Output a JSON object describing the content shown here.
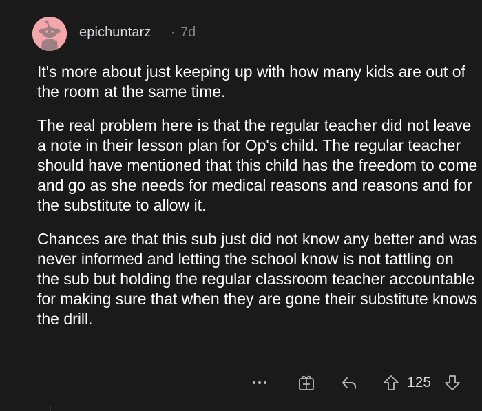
{
  "comment": {
    "username": "epichuntarz",
    "separator": "·",
    "age": "7d",
    "paragraphs": [
      "It's more about just keeping up with how many kids are out of the room at the same time.",
      "The real problem here is that the regular teacher did not leave a note in their lesson plan for Op's child. The regular teacher should have mentioned that this child has the freedom to come and go as she needs for medical reasons and reasons and for the substitute to allow it.",
      "Chances are that this sub just did not know any better and was never informed and letting the school know is not tattling on the sub but holding the regular classroom teacher accountable for making sure that when they are gone their substitute knows the drill."
    ],
    "score": "125"
  },
  "icons": {
    "avatar": "snoo-avatar",
    "more": "more-options-icon",
    "award": "award-gift-icon",
    "reply": "reply-icon",
    "upvote": "upvote-arrow-icon",
    "downvote": "downvote-arrow-icon"
  },
  "colors": {
    "background": "#1a1a1b",
    "text": "#ffffff",
    "meta": "#818384",
    "avatar_bg": "#f4a6ad",
    "avatar_figure": "#9e7f82"
  }
}
